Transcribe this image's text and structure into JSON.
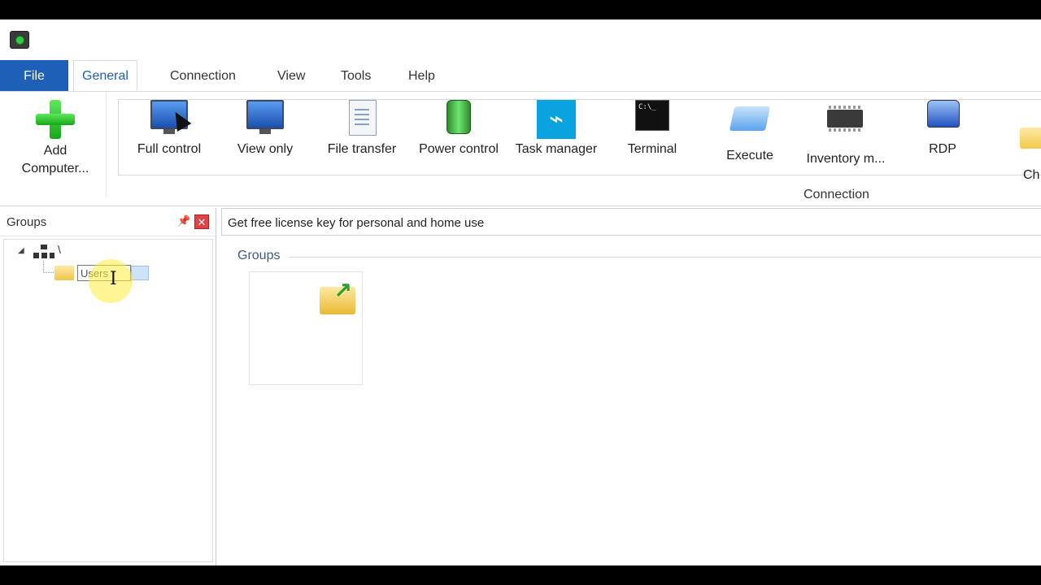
{
  "ribbon_tabs": {
    "file": "File",
    "general": "General",
    "connection": "Connection",
    "view": "View",
    "tools": "Tools",
    "help": "Help"
  },
  "ribbon": {
    "add_computer": "Add Computer...",
    "buttons": [
      {
        "label": "Full control",
        "icon": "monitor-icon"
      },
      {
        "label": "View only",
        "icon": "monitor-icon"
      },
      {
        "label": "File transfer",
        "icon": "document-icon"
      },
      {
        "label": "Power control",
        "icon": "battery-plug-icon"
      },
      {
        "label": "Task manager",
        "icon": "pulse-icon"
      },
      {
        "label": "Terminal",
        "icon": "terminal-icon"
      },
      {
        "label": "Execute",
        "icon": "execute-icon"
      },
      {
        "label": "Inventory m...",
        "icon": "chip-icon"
      },
      {
        "label": "RDP",
        "icon": "rdp-icon"
      },
      {
        "label": "Ch",
        "icon": "folder-icon"
      }
    ],
    "terminal_prompt": "C:\\_",
    "group_label": "Connection"
  },
  "groups_panel": {
    "title": "Groups",
    "root_label": "\\",
    "rename_value": "Users"
  },
  "content": {
    "license_text": "Get free license key for personal and home use",
    "section_title": "Groups"
  },
  "colors": {
    "accent": "#1e5fb8",
    "close": "#e04343"
  }
}
